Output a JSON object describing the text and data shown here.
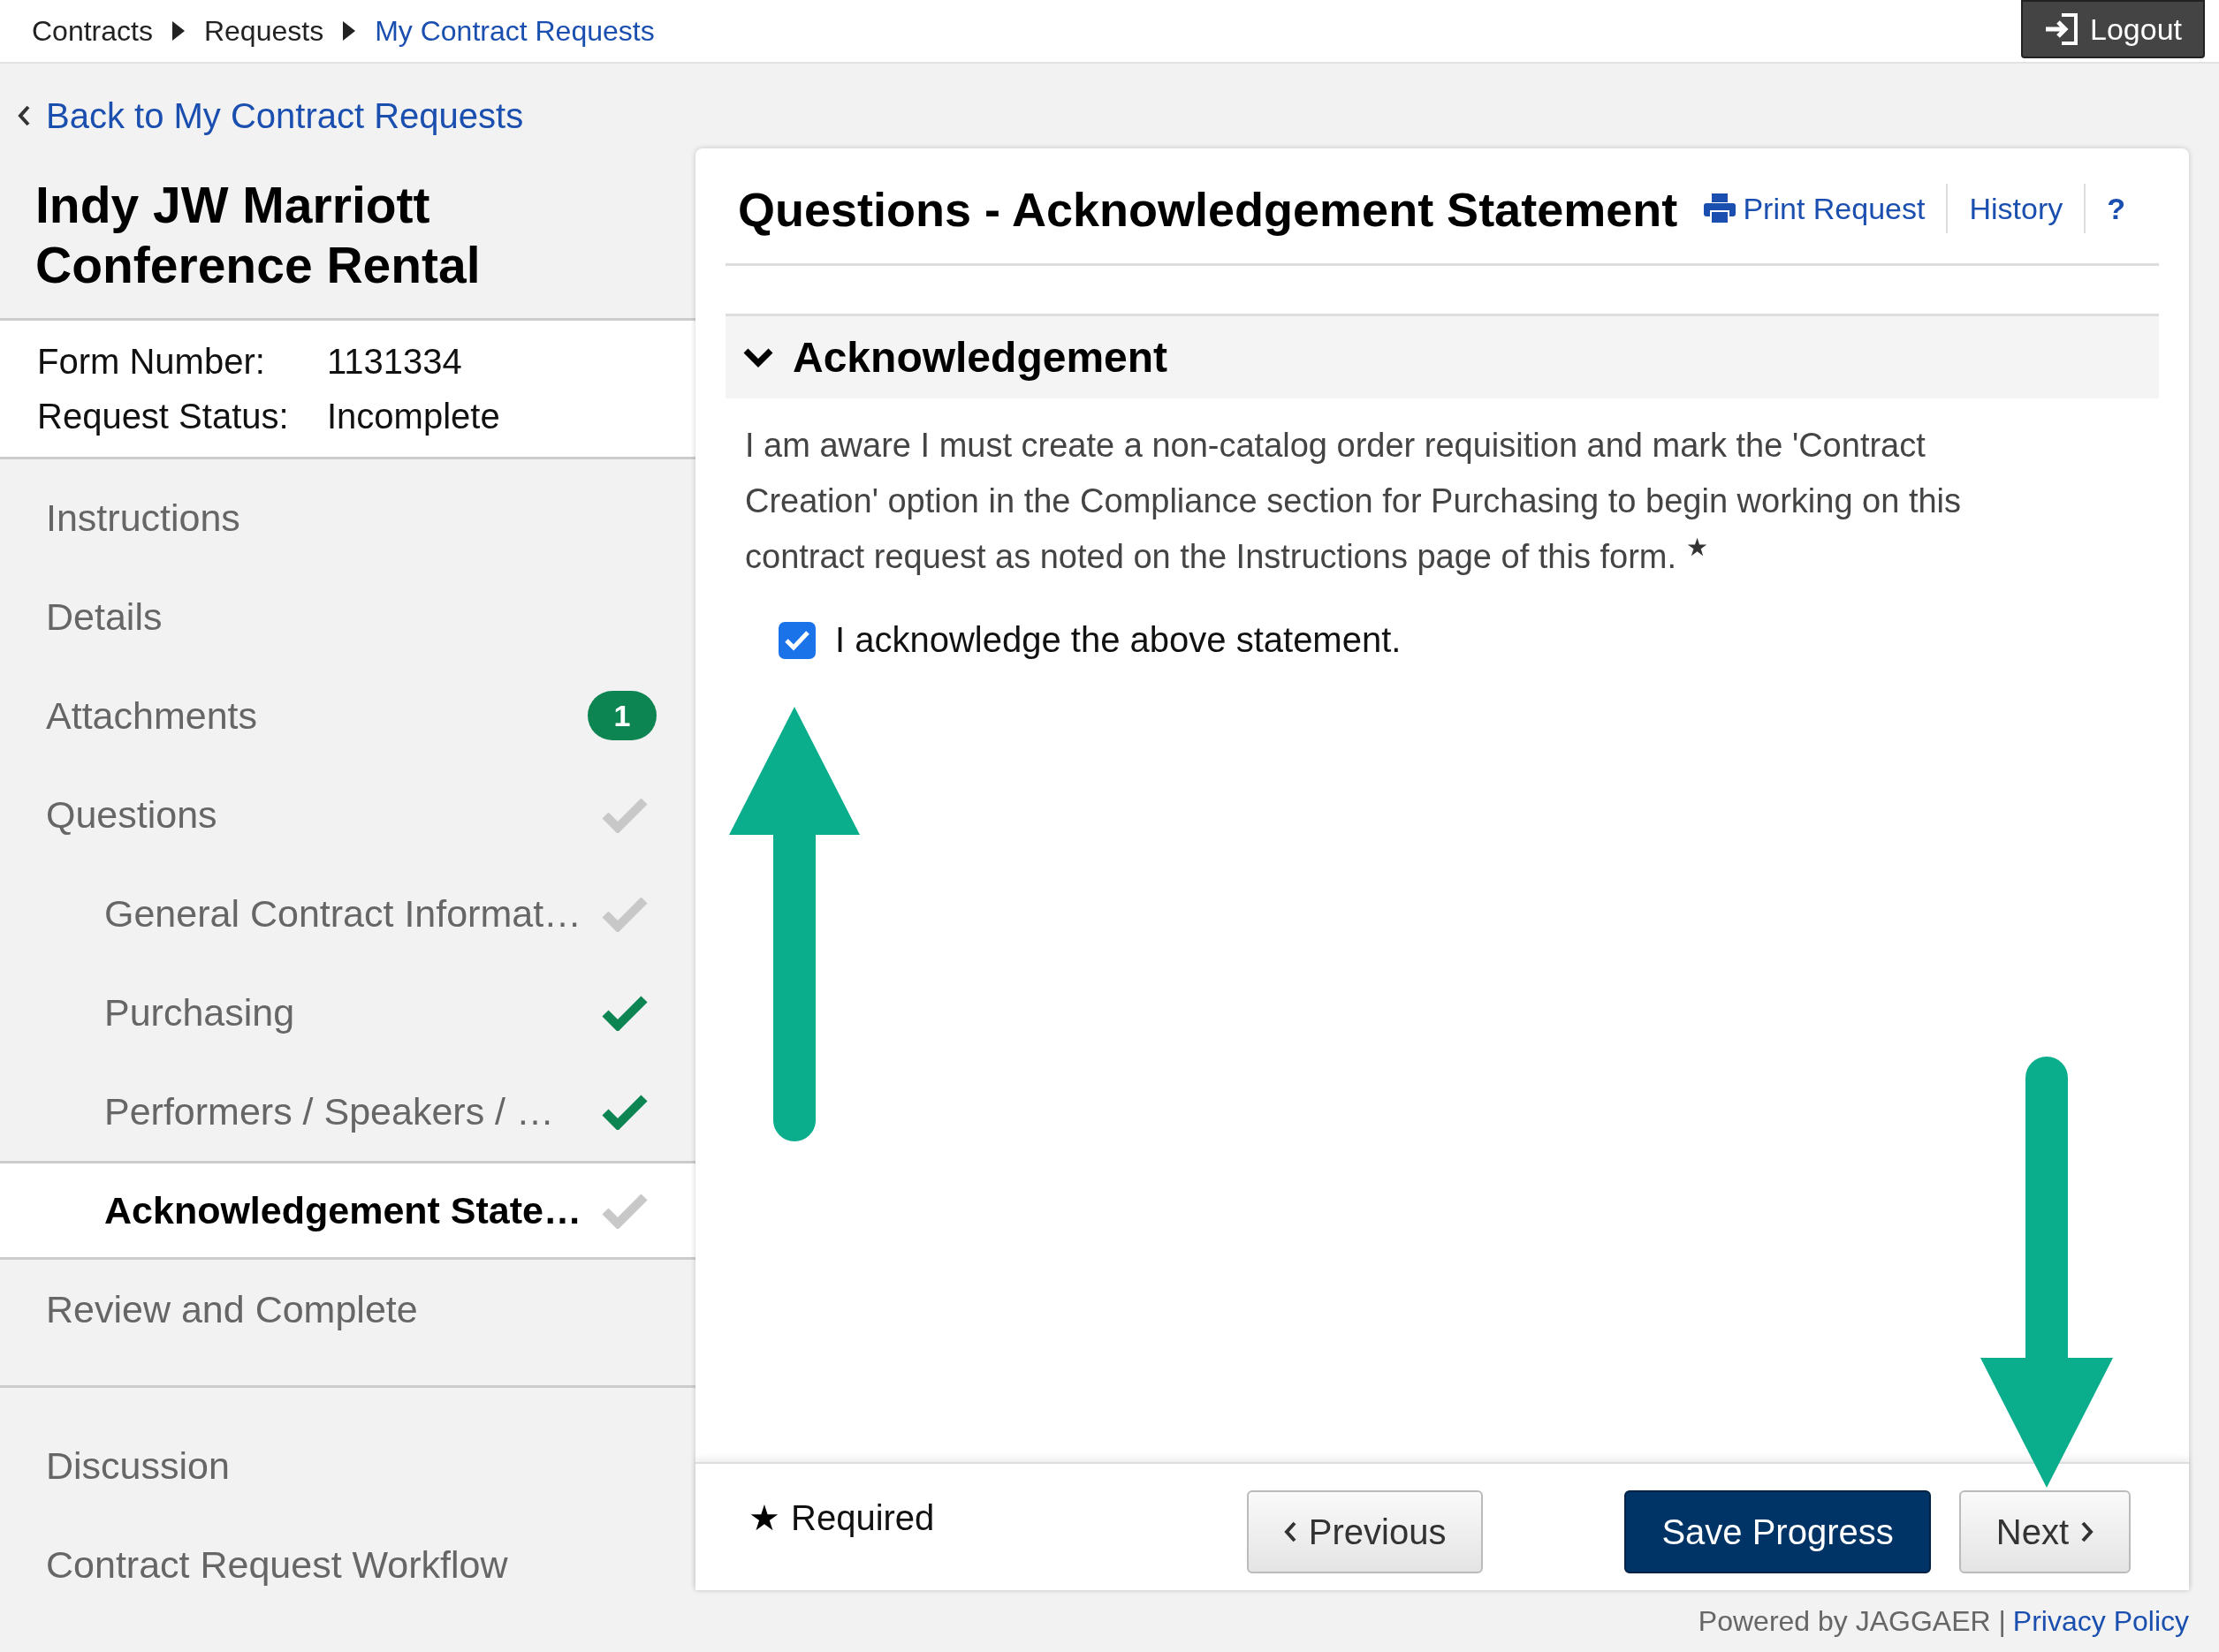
{
  "breadcrumb": [
    {
      "label": "Contracts",
      "current": false
    },
    {
      "label": "Requests",
      "current": false
    },
    {
      "label": "My Contract Requests",
      "current": true
    }
  ],
  "logout": {
    "label": "Logout"
  },
  "back_link": {
    "label": "Back to My Contract Requests"
  },
  "sidebar": {
    "title": "Indy JW Marriott Conference Rental",
    "info": [
      {
        "label": "Form Number:",
        "value": "1131334"
      },
      {
        "label": "Request Status:",
        "value": "Incomplete"
      }
    ],
    "items": [
      {
        "label": "Instructions",
        "kind": "section",
        "selected": false
      },
      {
        "label": "Details",
        "kind": "section",
        "selected": false
      },
      {
        "label": "Attachments",
        "kind": "section",
        "badge": "1",
        "selected": false
      },
      {
        "label": "Questions",
        "kind": "section",
        "completed": false,
        "selected": false
      },
      {
        "label": "General Contract Informat…",
        "kind": "sub",
        "completed": false,
        "selected": false
      },
      {
        "label": "Purchasing",
        "kind": "sub",
        "completed": true,
        "selected": false
      },
      {
        "label": "Performers / Speakers / …",
        "kind": "sub",
        "completed": true,
        "selected": false
      },
      {
        "label": "Acknowledgement State…",
        "kind": "sub",
        "completed": false,
        "selected": true
      },
      {
        "label": "Review and Complete",
        "kind": "section",
        "selected": false
      }
    ],
    "extra_items": [
      {
        "label": "Discussion"
      },
      {
        "label": "Contract Request Workflow"
      }
    ]
  },
  "main": {
    "title": "Questions - Acknowledgement Statement",
    "links": [
      {
        "label": "Print Request",
        "kind": "print"
      },
      {
        "label": "History",
        "kind": "plain"
      },
      {
        "label": "?",
        "kind": "help"
      }
    ],
    "section": {
      "title": "Acknowledgement",
      "expanded": true,
      "statement": "I am aware I must create a non-catalog order requisition and mark the 'Contract Creation' option in the Compliance section for Purchasing to begin working on this contract request as noted on the Instructions page of this form. $^{★}$",
      "checkbox": {
        "label": "I acknowledge the above statement.",
        "checked": true
      }
    }
  },
  "footer_bar": {
    "legend_mark": "★",
    "legend_label": "Required",
    "buttons": [
      {
        "label": "Previous",
        "kind": "previous"
      },
      {
        "label": "Save Progress",
        "kind": "primary"
      },
      {
        "label": "Next",
        "kind": "next"
      }
    ]
  },
  "page_footer": {
    "text": "Powered by JAGGAER |",
    "link": "Privacy Policy"
  }
}
